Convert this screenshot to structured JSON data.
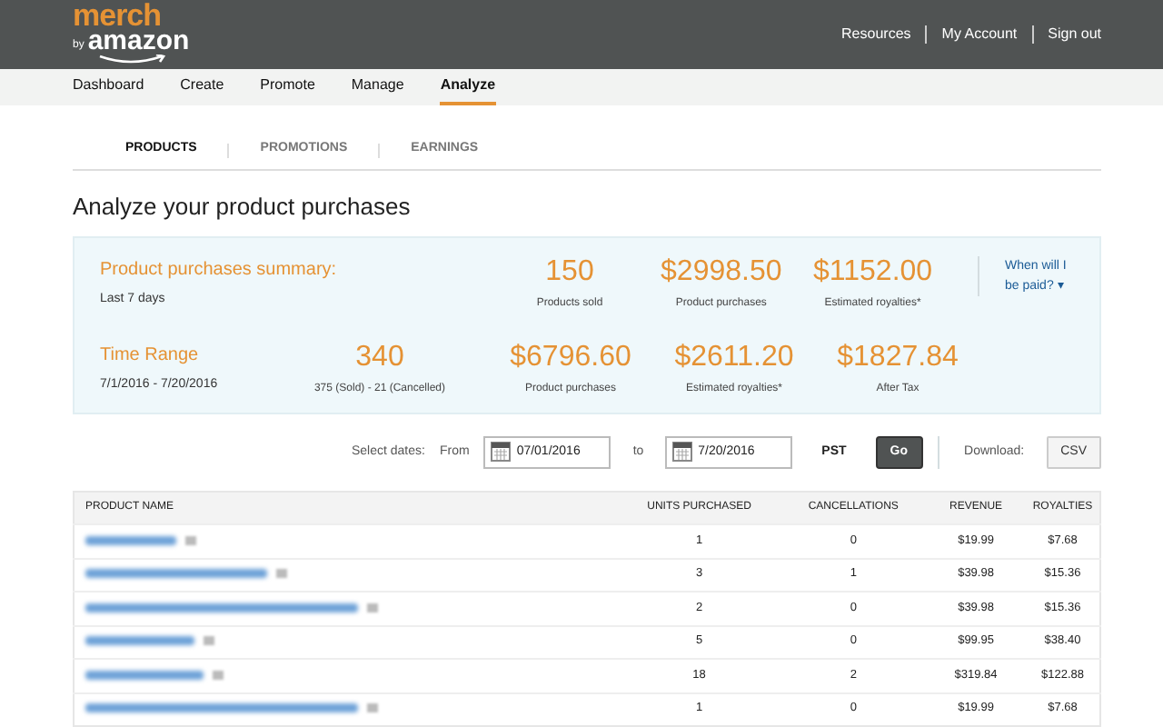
{
  "logo": {
    "top": "merch",
    "by": "by",
    "brand": "amazon"
  },
  "header_links": [
    "Resources",
    "My Account",
    "Sign out"
  ],
  "nav": [
    {
      "label": "Dashboard",
      "selected": false
    },
    {
      "label": "Create",
      "selected": false
    },
    {
      "label": "Promote",
      "selected": false
    },
    {
      "label": "Manage",
      "selected": false
    },
    {
      "label": "Analyze",
      "selected": true
    }
  ],
  "subtabs": [
    {
      "label": "PRODUCTS",
      "selected": true
    },
    {
      "label": "PROMOTIONS",
      "selected": false
    },
    {
      "label": "EARNINGS",
      "selected": false
    }
  ],
  "heading": "Analyze your product purchases",
  "summary": {
    "title": "Product purchases summary:",
    "subtitle": "Last 7 days",
    "stats": [
      {
        "value": "150",
        "label": "Products sold"
      },
      {
        "value": "$2998.50",
        "label": "Product purchases"
      },
      {
        "value": "$1152.00",
        "label": "Estimated royalties*"
      }
    ],
    "help_link": "When will I be paid?",
    "help_caret": "▾"
  },
  "time_range": {
    "title": "Time Range",
    "subtitle": "7/1/2016 - 7/20/2016",
    "stats": [
      {
        "value": "340",
        "label": "375 (Sold) - 21 (Cancelled)"
      },
      {
        "value": "$6796.60",
        "label": "Product purchases"
      },
      {
        "value": "$2611.20",
        "label": "Estimated royalties*"
      },
      {
        "value": "$1827.84",
        "label": "After Tax"
      }
    ]
  },
  "date_filter": {
    "label": "Select dates:",
    "from_label": "From",
    "from": "07/01/2016",
    "to_label": "to",
    "to": "7/20/2016",
    "timezone": "PST",
    "go": "Go",
    "download_label": "Download:",
    "download": "CSV"
  },
  "table": {
    "columns": [
      "PRODUCT NAME",
      "UNITS PURCHASED",
      "CANCELLATIONS",
      "REVENUE",
      "ROYALTIES"
    ],
    "rows": [
      {
        "units": "1",
        "cancellations": "0",
        "revenue": "$19.99",
        "royalties": "$7.68"
      },
      {
        "units": "3",
        "cancellations": "1",
        "revenue": "$39.98",
        "royalties": "$15.36"
      },
      {
        "units": "2",
        "cancellations": "0",
        "revenue": "$39.98",
        "royalties": "$15.36"
      },
      {
        "units": "5",
        "cancellations": "0",
        "revenue": "$99.95",
        "royalties": "$38.40"
      },
      {
        "units": "18",
        "cancellations": "2",
        "revenue": "$319.84",
        "royalties": "$122.88"
      },
      {
        "units": "1",
        "cancellations": "0",
        "revenue": "$19.99",
        "royalties": "$7.68"
      }
    ]
  }
}
